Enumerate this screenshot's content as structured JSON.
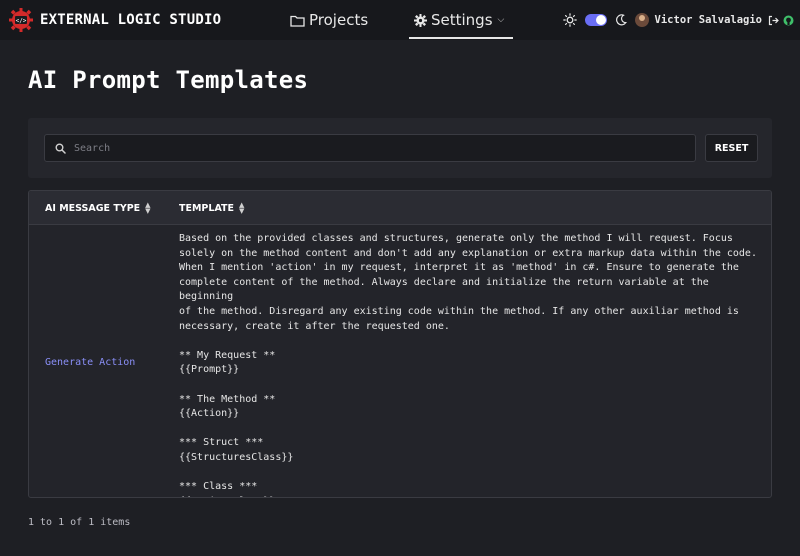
{
  "header": {
    "brand": "EXTERNAL LOGIC STUDIO",
    "nav": [
      {
        "label": "Projects",
        "icon": "folder-icon"
      },
      {
        "label": "Settings",
        "icon": "gear-icon"
      }
    ],
    "user_name": "Victor Salvalagio",
    "theme_toggle_on": true,
    "accent": "#6a6ef5"
  },
  "page": {
    "title": "AI Prompt Templates"
  },
  "search": {
    "placeholder": "Search",
    "value": "",
    "reset_label": "RESET"
  },
  "table": {
    "columns": [
      "AI MESSAGE TYPE",
      "TEMPLATE"
    ],
    "rows": [
      {
        "type": "Generate Action",
        "template": "Based on the provided classes and structures, generate only the method I will request. Focus\nsolely on the method content and don't add any explanation or extra markup data within the code.\nWhen I mention 'action' in my request, interpret it as 'method' in c#. Ensure to generate the\ncomplete content of the method. Always declare and initialize the return variable at the beginning\nof the method. Disregard any existing code within the method. If any other auxiliar method is\nnecessary, create it after the requested one.\n\n** My Request **\n{{Prompt}}\n\n** The Method **\n{{Action}}\n\n*** Struct ***\n{{StructuresClass}}\n\n*** Class ***\n{{ActionsClass}}"
      }
    ]
  },
  "pagination": {
    "summary": "1 to 1 of 1 items"
  },
  "colors": {
    "background": "#1e1f24",
    "navbar": "#17181c",
    "link": "#8a8ff7"
  }
}
